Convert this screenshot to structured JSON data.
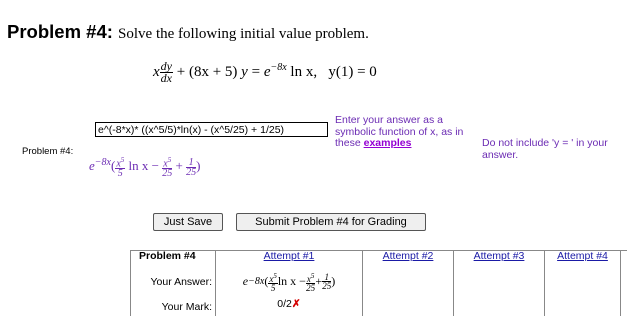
{
  "header": {
    "problem_title": "Problem #4:",
    "description": "Solve the following initial value problem."
  },
  "equation": {
    "lhs_x": "x",
    "dy": "dy",
    "dx": "dx",
    "plus1": "+ (8x + 5)",
    "y": "y",
    "equals": "=",
    "e": "e",
    "exp": "−8x",
    "ln": " ln x,",
    "ic": "y(1) = 0"
  },
  "problem_label": "Problem #4:",
  "answer": {
    "value": "e^(-8*x)* ((x^5/5)*ln(x) - (x^5/25) + 1/25)"
  },
  "hints": {
    "line1": "Enter your answer as a symbolic function of x, as in these",
    "link": "examples",
    "line2": "Do not include 'y = ' in your answer."
  },
  "preview": {
    "e": "e",
    "exp": "−8x",
    "open": "(",
    "f1_num": "x5",
    "f1_den": "5",
    "ln": " ln x −",
    "f2_num": "x5",
    "f2_den": "25",
    "plus": "+",
    "f3_num": "1",
    "f3_den": "25",
    "close": ")"
  },
  "buttons": {
    "save": "Just Save",
    "submit": "Submit Problem #4 for Grading"
  },
  "attempts": {
    "header": "Problem #4",
    "columns": [
      "Attempt #1",
      "Attempt #2",
      "Attempt #3",
      "Attempt #4"
    ],
    "your_answer_label": "Your Answer:",
    "your_mark_label": "Your Mark:",
    "mark_value": "0/2",
    "mark_symbol": "✗"
  },
  "colors": {
    "hint": "#6b2bb3",
    "link": "#9400d3",
    "attempt_link": "#1a1aa6",
    "wrong": "#d40000"
  }
}
